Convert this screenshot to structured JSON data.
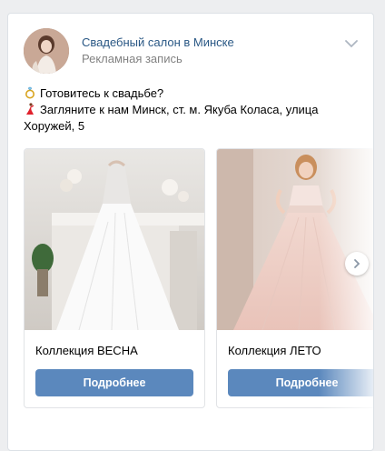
{
  "post": {
    "author": "Свадебный салон в Минске",
    "subline": "Рекламная запись",
    "text_line1": "Готовитесь к свадьбе?",
    "text_line2": "Загляните к нам Минск, ст. м. Якуба Коласа, улица",
    "text_line3": "Хоружей, 5",
    "emoji1": "ring-emoji",
    "emoji2": "dancer-emoji"
  },
  "carousel": {
    "cards": [
      {
        "title": "Коллекция ВЕСНА",
        "button": "Подробнее"
      },
      {
        "title": "Коллекция ЛЕТО",
        "button": "Подробнее"
      }
    ]
  },
  "colors": {
    "link": "#2a5885",
    "button": "#5b88bd",
    "secondary_text": "#828282"
  }
}
